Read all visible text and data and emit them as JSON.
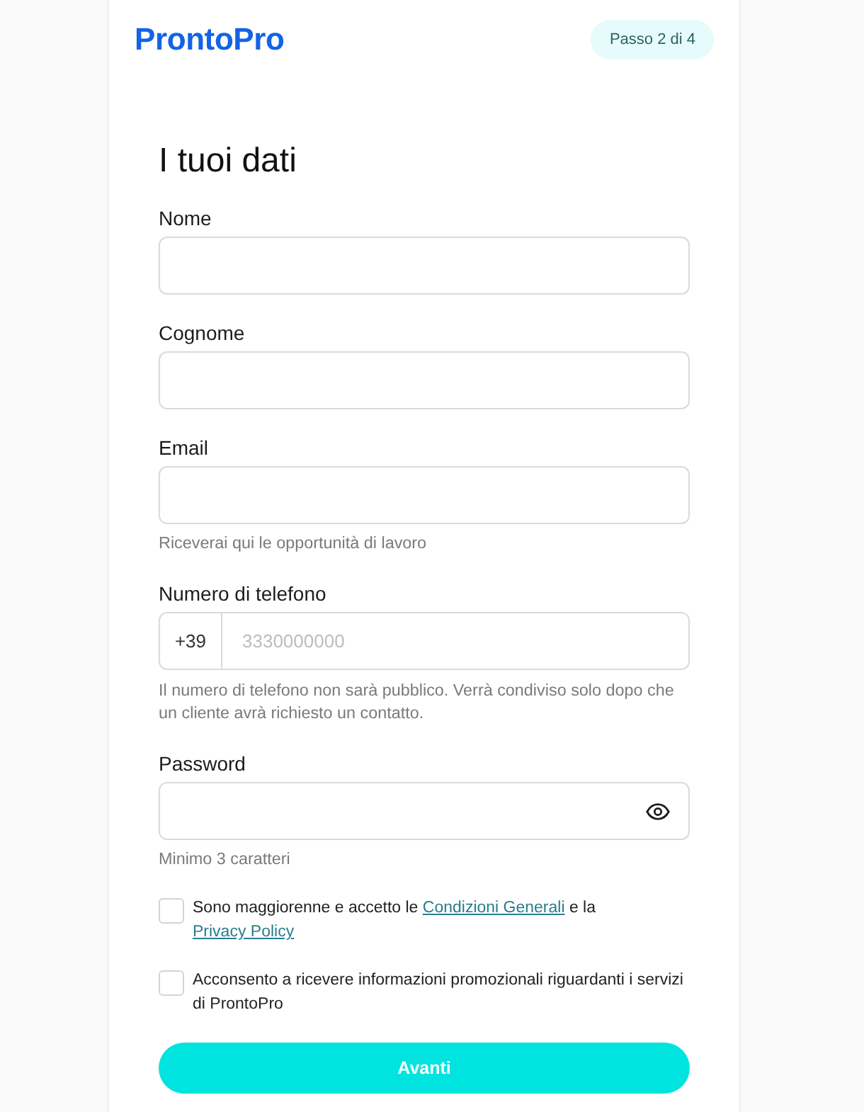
{
  "header": {
    "logo": "ProntoPro",
    "step_badge": "Passo 2 di 4"
  },
  "form": {
    "title": "I tuoi dati",
    "fields": [
      {
        "kind": "text",
        "label": "Nome"
      },
      {
        "kind": "text",
        "label": "Cognome"
      },
      {
        "kind": "text",
        "label": "Email",
        "hint": "Riceverai qui le opportunità di lavoro"
      },
      {
        "kind": "phone",
        "label": "Numero di telefono",
        "prefix": "+39",
        "placeholder": "3330000000",
        "hint": "Il numero di telefono non sarà pubblico. Verrà condiviso solo dopo che un cliente avrà richiesto un contatto."
      },
      {
        "kind": "password",
        "label": "Password",
        "hint": "Minimo 3 caratteri"
      }
    ],
    "consents": [
      {
        "checked": false,
        "parts": [
          {
            "kind": "text",
            "text": "Sono maggiorenne e accetto le "
          },
          {
            "kind": "link",
            "text": "Condizioni Generali"
          },
          {
            "kind": "text",
            "text": " e la "
          },
          {
            "kind": "link",
            "text": "Privacy Policy"
          }
        ]
      },
      {
        "checked": false,
        "parts": [
          {
            "kind": "text",
            "text": "Acconsento a ricevere informazioni promozionali riguardanti i servizi di ProntoPro"
          }
        ]
      }
    ],
    "submit_button": "Avanti"
  }
}
